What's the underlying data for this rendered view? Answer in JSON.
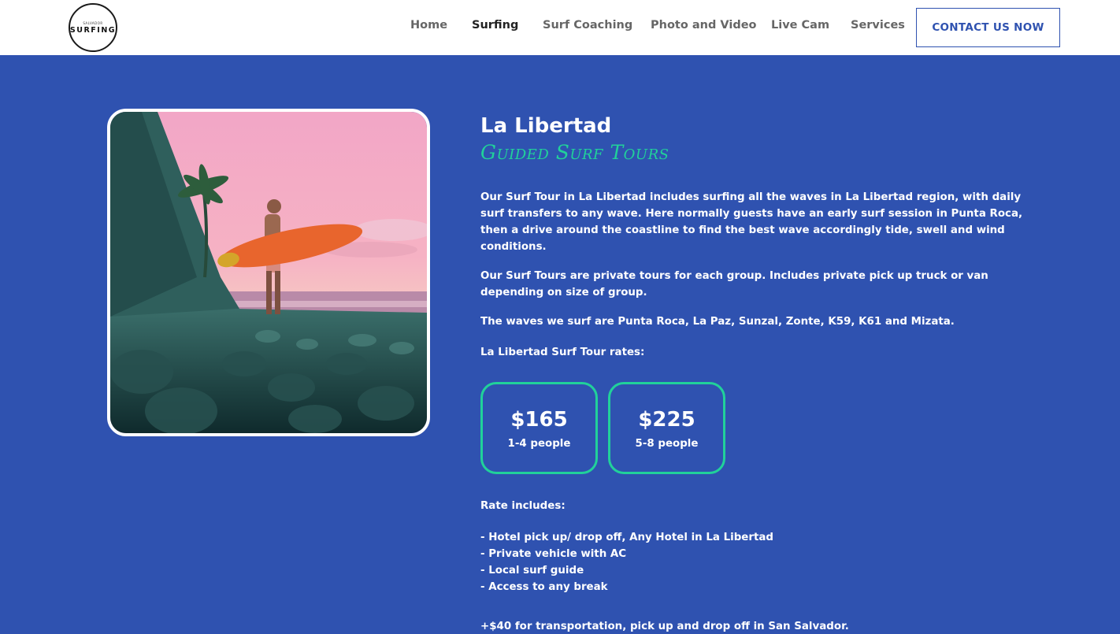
{
  "logo": {
    "small_text": "SALVADOR",
    "main_text": "SURFING"
  },
  "nav": {
    "items": [
      "Home",
      "Surfing",
      "Surf Coaching",
      "Photo and Video",
      "Live Cam",
      "Services"
    ],
    "active": "Surfing",
    "cta": "CONTACT US NOW"
  },
  "main": {
    "title": "La Libertad",
    "subtitle": "Guided Surf Tours",
    "paragraphs": [
      "Our Surf Tour in La Libertad includes surfing all the waves in La Libertad region, with daily surf transfers to any wave. Here normally guests have an early surf session in Punta Roca, then a drive around the coastline to find the best wave accordingly tide, swell and wind conditions.",
      "Our Surf Tours are private tours for each group. Includes private pick up truck or van depending on size of group.",
      "The waves we surf are Punta Roca, La Paz, Sunzal, Zonte, K59, K61 and Mizata."
    ],
    "rates_label": "La Libertad Surf Tour rates:",
    "rates": [
      {
        "price": "$165",
        "people": "1-4 people"
      },
      {
        "price": "$225",
        "people": "5-8 people"
      }
    ],
    "includes_label": "Rate includes:",
    "includes": [
      "- Hotel pick up/ drop off, Any Hotel in La Libertad",
      "- Private vehicle with AC",
      "- Local surf guide",
      "- Access to any break"
    ],
    "extra_note": "+$40 for transportation, pick up and drop off in San Salvador."
  },
  "colors": {
    "background": "#2f52b0",
    "accent": "#21d19a",
    "header_bg": "#ffffff"
  }
}
